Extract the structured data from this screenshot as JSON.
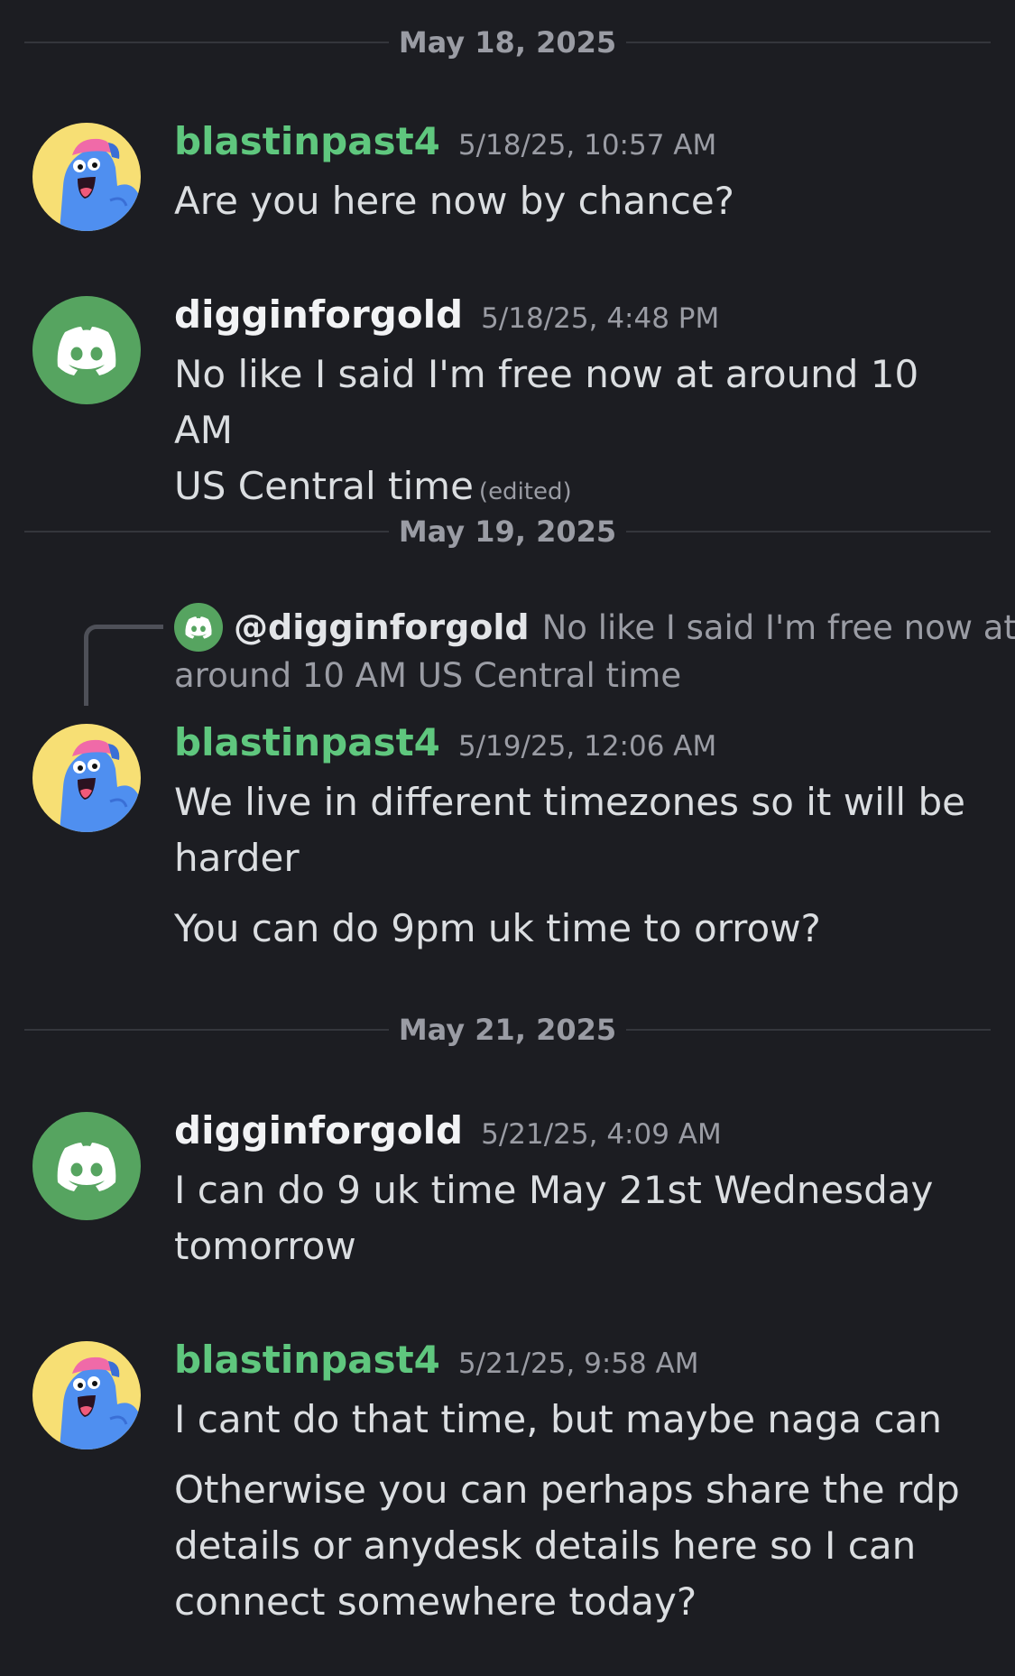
{
  "dividers": [
    {
      "label": "May 18, 2025"
    },
    {
      "label": "May 19, 2025"
    },
    {
      "label": "May 21, 2025"
    }
  ],
  "messages": [
    {
      "author": "blastinpast4",
      "timestamp": "5/18/25, 10:57 AM",
      "lines": [
        "Are you here now by chance?"
      ]
    },
    {
      "author": "digginforgold",
      "timestamp": "5/18/25, 4:48 PM",
      "lines": [
        "No like I said I'm free now at around 10 AM",
        "US Central time"
      ],
      "edited_label": "(edited)"
    },
    {
      "author": "blastinpast4",
      "timestamp": "5/19/25, 12:06 AM",
      "reply": {
        "mention": "@digginforgold",
        "preview_line1": "No like I said I'm free now at",
        "preview_line2": "around 10 AM US Central time"
      },
      "lines": [
        "We live in different timezones so it will be",
        "harder"
      ],
      "followup": [
        "You can do 9pm uk time to orrow?"
      ]
    },
    {
      "author": "digginforgold",
      "timestamp": "5/21/25, 4:09 AM",
      "lines": [
        "I can do 9 uk time May 21st Wednesday",
        "tomorrow"
      ]
    },
    {
      "author": "blastinpast4",
      "timestamp": "5/21/25, 9:58 AM",
      "lines": [
        "I cant do that time, but maybe naga can"
      ],
      "followup": [
        "Otherwise you can perhaps share the rdp",
        "details or anydesk details here so I can",
        "connect somewhere today?"
      ]
    }
  ],
  "icons": {
    "discord_avatar": "discord-logo-icon",
    "mascot_avatar": "blue-mascot-avatar-icon"
  },
  "colors": {
    "background": "#1c1d22",
    "username_green": "#5fc77e",
    "discord_avatar_bg": "#56a460",
    "mascot_avatar_bg": "#f7df74"
  }
}
